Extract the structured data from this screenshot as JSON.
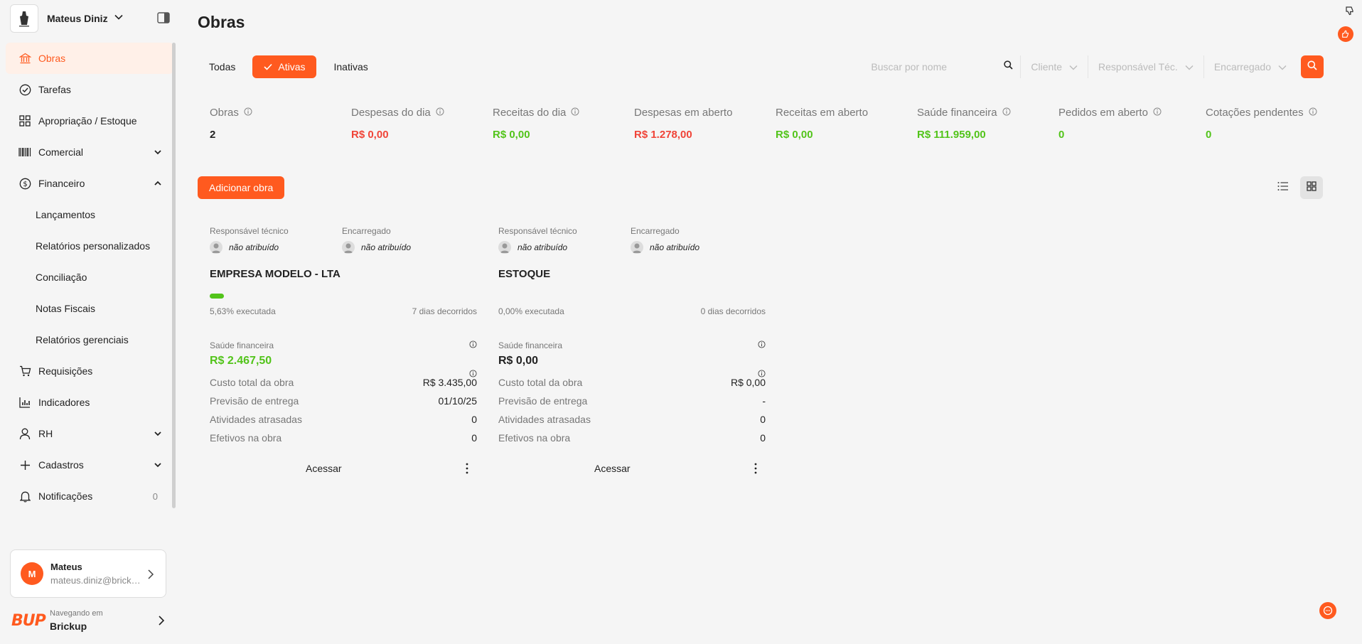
{
  "sidebar": {
    "org_name": "Mateus Diniz",
    "menu": {
      "obras": "Obras",
      "tarefas": "Tarefas",
      "apropriacao": "Apropriação / Estoque",
      "comercial": "Comercial",
      "financeiro": "Financeiro",
      "sub": [
        "Lançamentos",
        "Relatórios personalizados",
        "Conciliação",
        "Notas Fiscais",
        "Relatórios gerenciais"
      ],
      "requisicoes": "Requisições",
      "indicadores": "Indicadores",
      "rh": "RH",
      "cadastros": "Cadastros",
      "notificacoes": "Notificações",
      "notificacoes_count": "0"
    },
    "user": {
      "initial": "M",
      "name": "Mateus",
      "email": "mateus.diniz@brickup.com.br"
    },
    "navigating": {
      "logo": "BUP",
      "label": "Navegando em",
      "name": "Brickup"
    }
  },
  "header": {
    "title": "Obras"
  },
  "tabs": {
    "todas": "Todas",
    "ativas": "Ativas",
    "inativas": "Inativas"
  },
  "filters": {
    "search_placeholder": "Buscar por nome",
    "cliente": "Cliente",
    "responsavel": "Responsável Téc.",
    "encarregado": "Encarregado"
  },
  "stats": [
    {
      "label": "Obras",
      "value": "2",
      "color": "dark",
      "info": true
    },
    {
      "label": "Despesas do dia",
      "value": "R$ 0,00",
      "color": "red",
      "info": true
    },
    {
      "label": "Receitas do dia",
      "value": "R$ 0,00",
      "color": "green",
      "info": true
    },
    {
      "label": "Despesas em aberto",
      "value": "R$ 1.278,00",
      "color": "red",
      "info": false
    },
    {
      "label": "Receitas em aberto",
      "value": "R$ 0,00",
      "color": "green",
      "info": false
    },
    {
      "label": "Saúde financeira",
      "value": "R$ 111.959,00",
      "color": "green",
      "info": true
    },
    {
      "label": "Pedidos em aberto",
      "value": "0",
      "color": "green",
      "info": true
    },
    {
      "label": "Cotações pendentes",
      "value": "0",
      "color": "green",
      "info": true
    }
  ],
  "actions": {
    "add": "Adicionar obra"
  },
  "card_labels": {
    "responsavel": "Responsável técnico",
    "encarregado": "Encarregado",
    "saude": "Saúde financeira",
    "custo": "Custo total da obra",
    "previsao": "Previsão de entrega",
    "atrasadas": "Atividades atrasadas",
    "efetivos": "Efetivos na obra",
    "acessar": "Acessar"
  },
  "cards": [
    {
      "responsavel": "não atribuído",
      "encarregado": "não atribuído",
      "title": "EMPRESA MODELO - LTA",
      "progress": 0.0563,
      "executada": "5,63% executada",
      "dias": "7 dias decorridos",
      "saude": "R$ 2.467,50",
      "saude_color": "green",
      "custo": "R$ 3.435,00",
      "previsao": "01/10/25",
      "atrasadas": "0",
      "efetivos": "0"
    },
    {
      "responsavel": "não atribuído",
      "encarregado": "não atribuído",
      "title": "ESTOQUE",
      "progress": 0,
      "executada": "0,00% executada",
      "dias": "0 dias decorridos",
      "saude": "R$ 0,00",
      "saude_color": "dark",
      "custo": "R$ 0,00",
      "previsao": "-",
      "atrasadas": "0",
      "efetivos": "0"
    }
  ],
  "colors": {
    "accent": "#ff5a1f",
    "positive": "#52c41a",
    "negative": "#f04438"
  }
}
